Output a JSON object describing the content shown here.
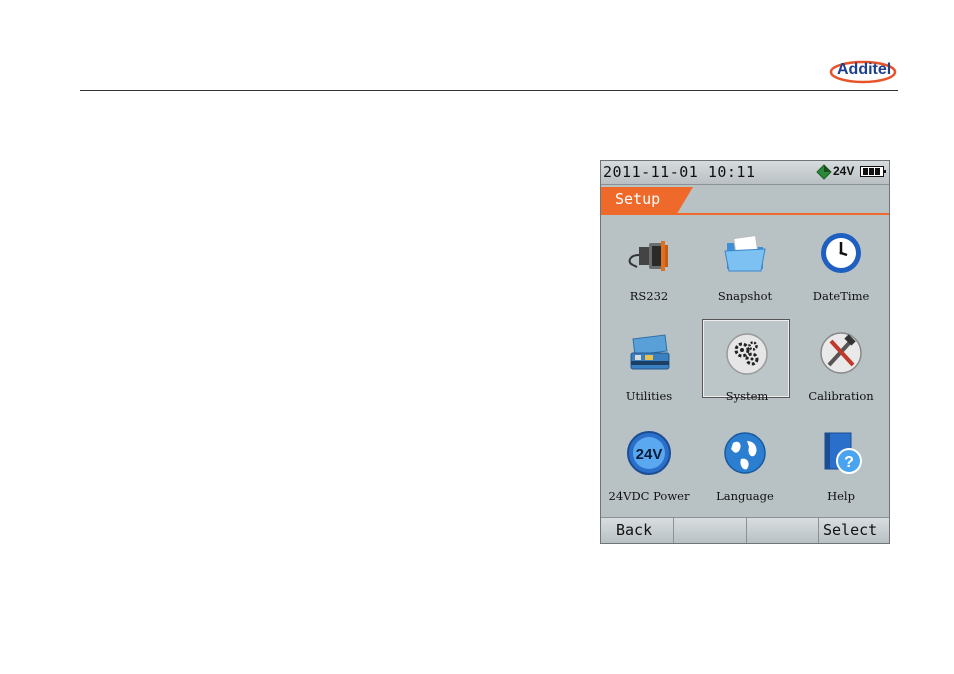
{
  "brand": {
    "logo_text": "Additel",
    "logo_color": "#1f3f8f",
    "swoosh_color": "#e8542a"
  },
  "status": {
    "datetime": "2011-11-01 10:11",
    "power_label": "24V",
    "power_icon": "diamond-power-icon",
    "battery_level": 1.0
  },
  "tab": {
    "label": "Setup",
    "accent": "#ef6a2a"
  },
  "menu": {
    "items": [
      {
        "label": "RS232",
        "icon": "serial-cable-icon"
      },
      {
        "label": "Snapshot",
        "icon": "folder-icon"
      },
      {
        "label": "DateTime",
        "icon": "clock-icon"
      },
      {
        "label": "Utilities",
        "icon": "toolbox-icon"
      },
      {
        "label": "System",
        "icon": "gears-icon",
        "selected": true
      },
      {
        "label": "Calibration",
        "icon": "tools-icon"
      },
      {
        "label": "24VDC Power",
        "icon": "24v-power-icon",
        "badge": "24V"
      },
      {
        "label": "Language",
        "icon": "globe-icon"
      },
      {
        "label": "Help",
        "icon": "help-book-icon",
        "badge": "?"
      }
    ]
  },
  "softkeys": {
    "left": "Back",
    "middle1": "",
    "middle2": "",
    "right": "Select"
  }
}
